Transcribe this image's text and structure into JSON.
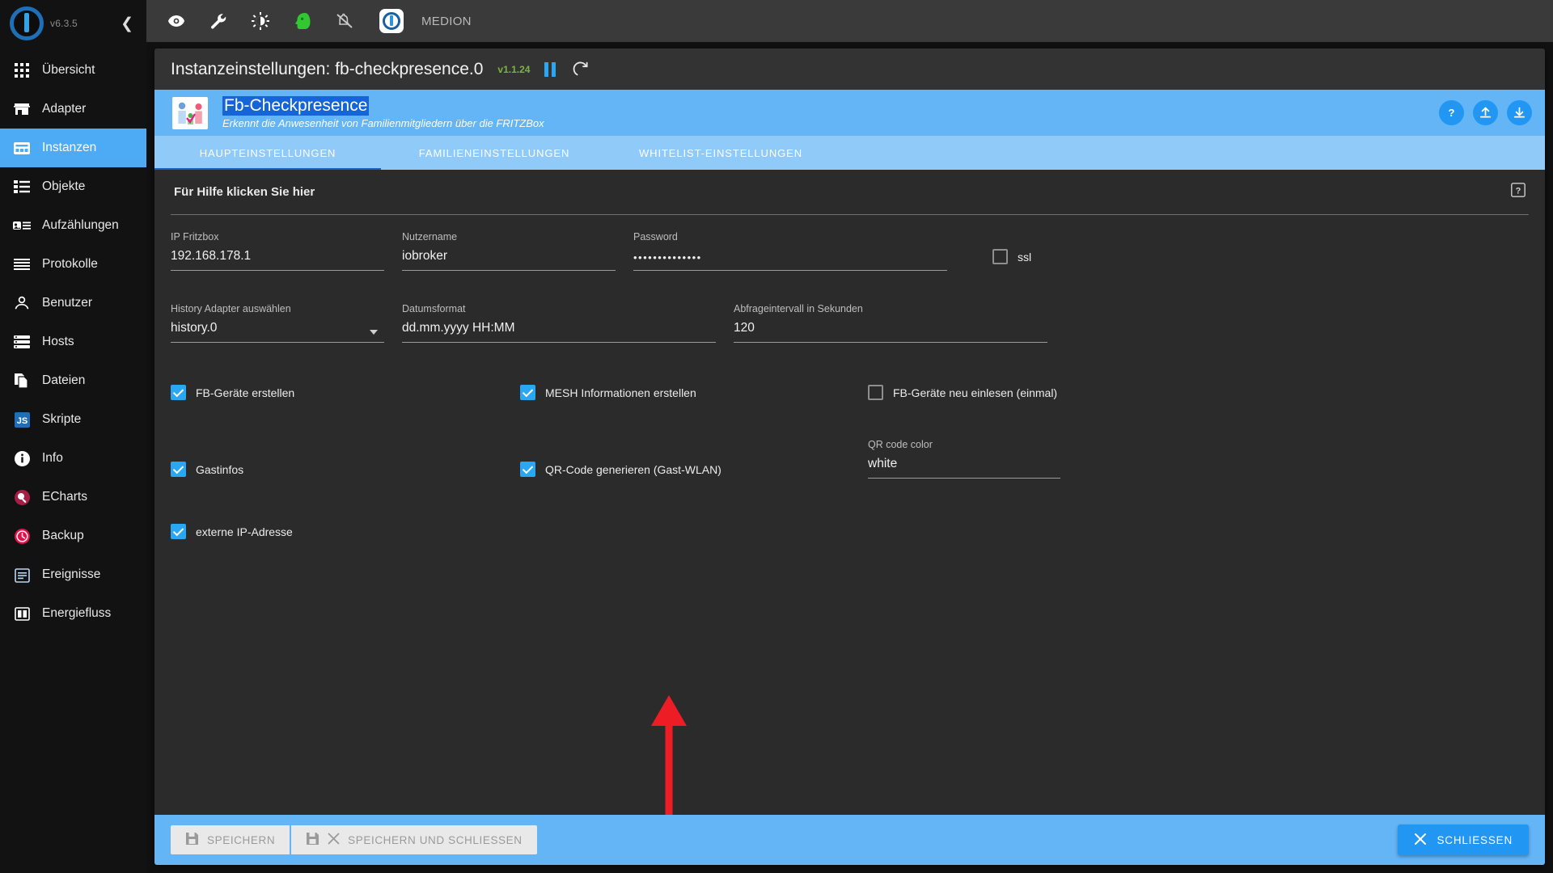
{
  "sidebar": {
    "version": "v6.3.5",
    "collapse_icon": "chevron-left-icon",
    "logo_icon": "iobroker-logo-icon",
    "items": [
      {
        "label": "Übersicht",
        "icon": "grid-icon",
        "active": false
      },
      {
        "label": "Adapter",
        "icon": "store-icon",
        "active": false
      },
      {
        "label": "Instanzen",
        "icon": "instances-icon",
        "active": true
      },
      {
        "label": "Objekte",
        "icon": "list-icon",
        "active": false
      },
      {
        "label": "Aufzählungen",
        "icon": "enums-icon",
        "active": false
      },
      {
        "label": "Protokolle",
        "icon": "logs-icon",
        "active": false
      },
      {
        "label": "Benutzer",
        "icon": "user-icon",
        "active": false
      },
      {
        "label": "Hosts",
        "icon": "server-icon",
        "active": false
      },
      {
        "label": "Dateien",
        "icon": "files-icon",
        "active": false
      },
      {
        "label": "Skripte",
        "icon": "javascript-icon",
        "active": false
      },
      {
        "label": "Info",
        "icon": "info-icon",
        "active": false
      },
      {
        "label": "ECharts",
        "icon": "echarts-icon",
        "active": false
      },
      {
        "label": "Backup",
        "icon": "backup-icon",
        "active": false
      },
      {
        "label": "Ereignisse",
        "icon": "events-icon",
        "active": false
      },
      {
        "label": "Energiefluss",
        "icon": "energy-icon",
        "active": false
      }
    ]
  },
  "topbar": {
    "host_name": "MEDION",
    "icons": [
      "eye-icon",
      "wrench-icon",
      "brightness-icon",
      "expert-mode-head-icon",
      "notifications-off-icon"
    ],
    "logo_icon": "iobroker-logo-icon"
  },
  "modal": {
    "title": "Instanzeinstellungen: fb-checkpresence.0",
    "version_badge": "v1.1.24",
    "pause_icon": "pause-icon",
    "refresh_icon": "refresh-icon"
  },
  "adapter": {
    "name": "Fb-Checkpresence",
    "description": "Erkennt die Anwesenheit von Familienmitgliedern über die FRITZBox",
    "logo_icon": "fb-checkpresence-logo-icon",
    "actions": [
      {
        "icon": "help-question-icon",
        "name": "help-button"
      },
      {
        "icon": "upload-icon",
        "name": "upload-config-button"
      },
      {
        "icon": "download-icon",
        "name": "download-config-button"
      }
    ]
  },
  "tabs": [
    {
      "label": "HAUPTEINSTELLUNGEN",
      "active": true
    },
    {
      "label": "FAMILIENEINSTELLUNGEN",
      "active": false
    },
    {
      "label": "WHITELIST-EINSTELLUNGEN",
      "active": false
    }
  ],
  "help": {
    "text": "Für Hilfe klicken Sie hier",
    "icon": "help-question-icon"
  },
  "form": {
    "row1": [
      {
        "label": "IP Fritzbox",
        "value": "192.168.178.1",
        "type": "text"
      },
      {
        "label": "Nutzername",
        "value": "iobroker",
        "type": "text"
      },
      {
        "label": "Password",
        "value": "••••••••••••••",
        "type": "password"
      }
    ],
    "ssl_checkbox": {
      "label": "ssl",
      "checked": false
    },
    "row2": [
      {
        "label": "History Adapter auswählen",
        "value": "history.0",
        "type": "select"
      },
      {
        "label": "Datumsformat",
        "value": "dd.mm.yyyy HH:MM",
        "type": "text"
      },
      {
        "label": "Abfrageintervall in Sekunden",
        "value": "120",
        "type": "text"
      }
    ],
    "checkboxes_row1": [
      {
        "label": "FB-Geräte erstellen",
        "checked": true
      },
      {
        "label": "MESH Informationen erstellen",
        "checked": true
      },
      {
        "label": "FB-Geräte neu einlesen (einmal)",
        "checked": false
      }
    ],
    "checkboxes_row2": [
      {
        "label": "Gastinfos",
        "checked": true
      },
      {
        "label": "QR-Code generieren (Gast-WLAN)",
        "checked": true
      }
    ],
    "qr_color": {
      "label": "QR code color",
      "value": "white"
    },
    "checkboxes_row3": [
      {
        "label": "externe IP-Adresse",
        "checked": true
      }
    ]
  },
  "annotation": {
    "arrow_color": "#ee1c24",
    "points_to": "QR-Code generieren (Gast-WLAN)"
  },
  "footer": {
    "save_label": "SPEICHERN",
    "save_close_label": "SPEICHERN UND SCHLIESSEN",
    "close_label": "SCHLIESSEN",
    "save_icon": "save-icon",
    "close_icon": "close-x-icon"
  },
  "colors": {
    "accent": "#4dabf5",
    "header": "#64b5f6",
    "tabs": "#90caf9",
    "selection": "#1565d8"
  }
}
